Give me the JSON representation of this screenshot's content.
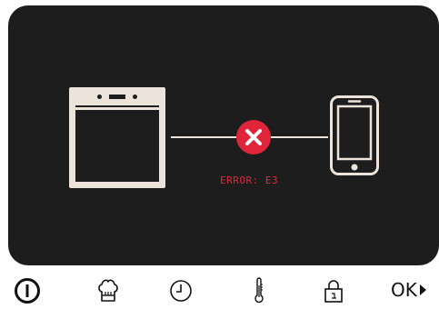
{
  "status": {
    "error_text": "ERROR: E3",
    "error_color": "#e0243a",
    "connection_state": "failed"
  },
  "devices": {
    "left": "oven-icon",
    "right": "smartphone-icon"
  },
  "toolbar": {
    "items": [
      {
        "name": "power-icon"
      },
      {
        "name": "chef-hat-icon"
      },
      {
        "name": "clock-icon"
      },
      {
        "name": "thermometer-icon"
      },
      {
        "name": "lock-icon"
      }
    ],
    "ok_label": "OK"
  },
  "colors": {
    "screen_bg": "#1d1d1d",
    "foreground": "#ece4da",
    "error": "#e0243a"
  }
}
